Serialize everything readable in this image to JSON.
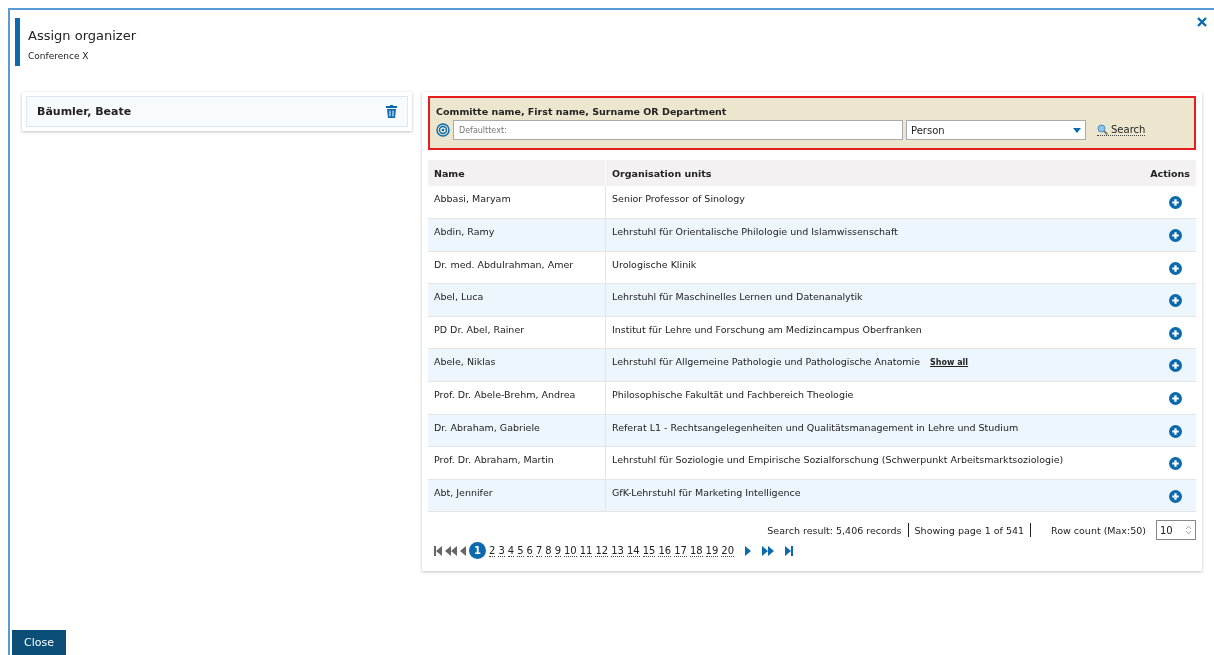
{
  "dialog": {
    "title": "Assign organizer",
    "subtitle": "Conference X"
  },
  "selected_people": [
    {
      "name": "Bäumler, Beate"
    }
  ],
  "search": {
    "label": "Committe name, First name, Surname OR Department",
    "placeholder": "Defaulttext:",
    "type": "Person",
    "button": "Search"
  },
  "table": {
    "columns": [
      "Name",
      "Organisation units",
      "Actions"
    ],
    "rows": [
      {
        "name": "Abbasi, Maryam",
        "unit": "Senior Professor of Sinology"
      },
      {
        "name": "Abdin, Ramy",
        "unit": "Lehrstuhl für Orientalische Philologie und Islamwissenschaft"
      },
      {
        "name": "Dr. med. Abdulrahman, Amer",
        "unit": "Urologische Klinik"
      },
      {
        "name": "Abel, Luca",
        "unit": "Lehrstuhl für Maschinelles Lernen und Datenanalytik"
      },
      {
        "name": "PD Dr. Abel, Rainer",
        "unit": "Institut für Lehre und Forschung am Medizincampus Oberfranken"
      },
      {
        "name": "Abele, Niklas",
        "unit": "Lehrstuhl für Allgemeine Pathologie und Pathologische Anatomie",
        "link": "Show all"
      },
      {
        "name": "Prof. Dr. Abele-Brehm, Andrea",
        "unit": "Philosophische Fakultät und Fachbereich Theologie"
      },
      {
        "name": "Dr. Abraham, Gabriele",
        "unit": "Referat L1 - Rechtsangelegenheiten und Qualitätsmanagement in Lehre und Studium"
      },
      {
        "name": "Prof. Dr. Abraham, Martin",
        "unit": "Lehrstuhl für Soziologie und Empirische Sozialforschung (Schwerpunkt Arbeitsmarktsoziologie)"
      },
      {
        "name": "Abt, Jennifer",
        "unit": "GfK-Lehrstuhl für Marketing Intelligence"
      }
    ]
  },
  "summary": {
    "result": "Search result: 5,406 records",
    "page": "Showing page 1 of 541",
    "row_count_label": "Row count (Max:50)",
    "row_count": "10"
  },
  "pages": [
    {
      "label": "1",
      "selected": true
    },
    {
      "label": "2",
      "selected": false
    },
    {
      "label": "3",
      "selected": false
    },
    {
      "label": "4",
      "selected": false
    },
    {
      "label": "5",
      "selected": false
    },
    {
      "label": "6",
      "selected": false
    },
    {
      "label": "7",
      "selected": false
    },
    {
      "label": "8",
      "selected": false
    },
    {
      "label": "9",
      "selected": false
    },
    {
      "label": "10",
      "selected": false
    },
    {
      "label": "11",
      "selected": false
    },
    {
      "label": "12",
      "selected": false
    },
    {
      "label": "13",
      "selected": false
    },
    {
      "label": "14",
      "selected": false
    },
    {
      "label": "15",
      "selected": false
    },
    {
      "label": "16",
      "selected": false
    },
    {
      "label": "17",
      "selected": false
    },
    {
      "label": "18",
      "selected": false
    },
    {
      "label": "19",
      "selected": false
    },
    {
      "label": "20",
      "selected": false
    }
  ],
  "close_button": "Close"
}
